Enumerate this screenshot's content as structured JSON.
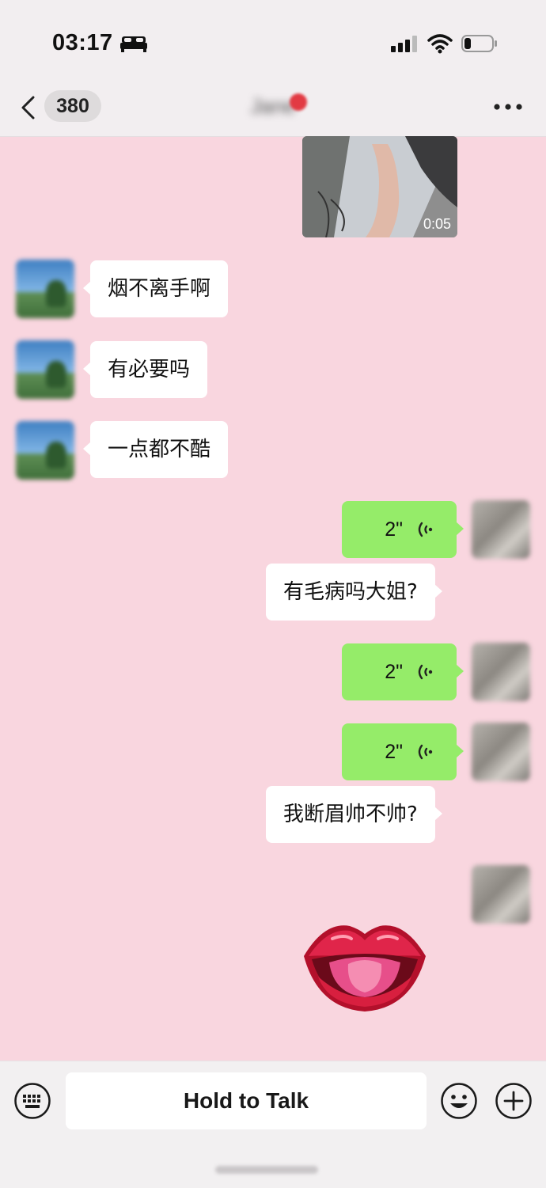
{
  "status_bar": {
    "time": "03:17",
    "icons": [
      "bed-icon",
      "signal-icon",
      "wifi-icon",
      "battery-icon"
    ]
  },
  "nav": {
    "unread_count": "380",
    "title": "Jane",
    "icons": [
      "back-chevron-icon",
      "more-icon"
    ]
  },
  "messages": [
    {
      "side": "right",
      "type": "video",
      "duration": "0:05"
    },
    {
      "side": "left",
      "type": "text",
      "text": "烟不离手啊"
    },
    {
      "side": "left",
      "type": "text",
      "text": "有必要吗"
    },
    {
      "side": "left",
      "type": "text",
      "text": "一点都不酷"
    },
    {
      "side": "right",
      "type": "voice",
      "duration": "2\""
    },
    {
      "side": "right",
      "type": "text",
      "text": "有毛病吗大姐?"
    },
    {
      "side": "right",
      "type": "voice",
      "duration": "2\""
    },
    {
      "side": "right",
      "type": "voice",
      "duration": "2\""
    },
    {
      "side": "right",
      "type": "text",
      "text": "我断眉帅不帅?"
    },
    {
      "side": "right",
      "type": "sticker",
      "sticker": "lips-sticker"
    }
  ],
  "input_bar": {
    "hold_to_talk_label": "Hold to Talk",
    "icons": [
      "keyboard-icon",
      "emoji-icon",
      "plus-icon"
    ]
  },
  "colors": {
    "chat_background": "#f9d6df",
    "sent_voice_bubble": "#95ec69",
    "text_bubble": "#ffffff",
    "bars": "#f2eef0"
  }
}
